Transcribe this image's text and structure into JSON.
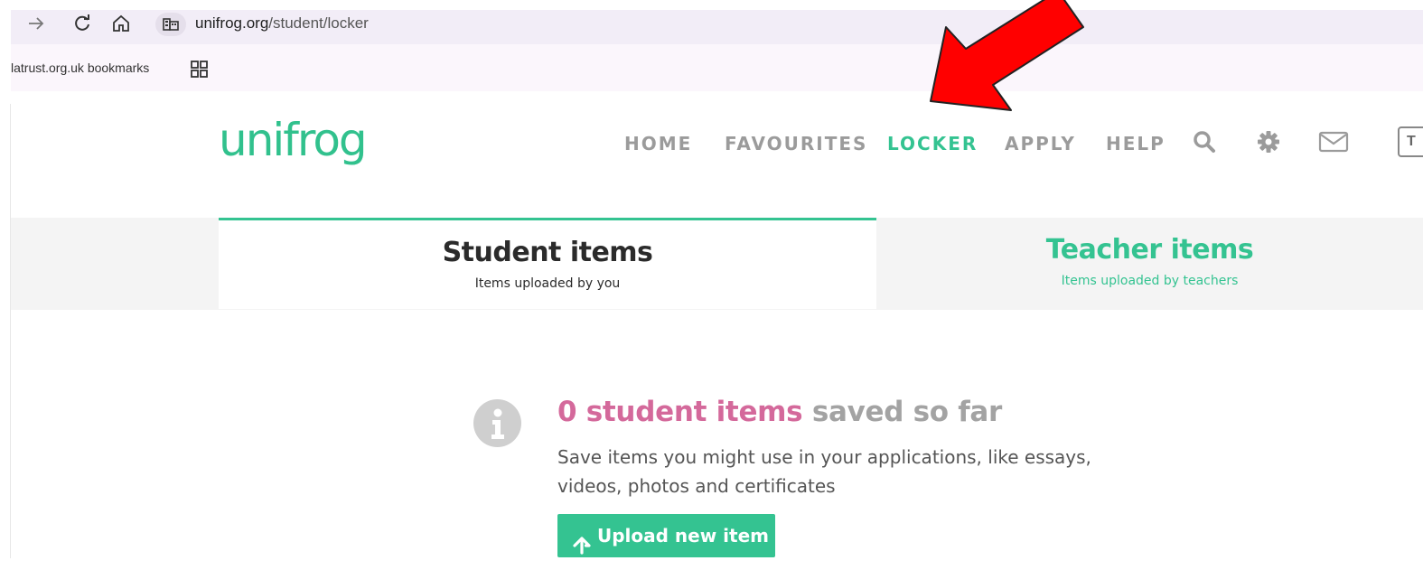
{
  "browser": {
    "url_host": "unifrog.org",
    "url_path": "/student/locker",
    "bookmarks_label": "latrust.org.uk bookmarks"
  },
  "site": {
    "logo": "unifrog",
    "nav": {
      "home": "HOME",
      "favourites": "FAVOURITES",
      "locker": "LOCKER",
      "apply": "APPLY",
      "help": "HELP"
    },
    "lang_initial": "T",
    "accent_color": "#34c391",
    "pink_color": "#d4699b"
  },
  "tabs": {
    "student": {
      "title": "Student items",
      "subtitle": "Items uploaded by you"
    },
    "teacher": {
      "title": "Teacher items",
      "subtitle": "Items uploaded by teachers"
    }
  },
  "empty_state": {
    "count_text": "0 student items",
    "suffix_text": " saved so far",
    "description": "Save items you might use in your applications, like essays, videos, photos and certificates",
    "upload_label": "Upload new item"
  },
  "icons": [
    "forward-arrow-icon",
    "reload-icon",
    "home-icon",
    "site-info-icon",
    "apps-grid-icon",
    "search-icon",
    "gear-icon",
    "mail-icon",
    "info-icon",
    "upload-arrow-icon"
  ]
}
